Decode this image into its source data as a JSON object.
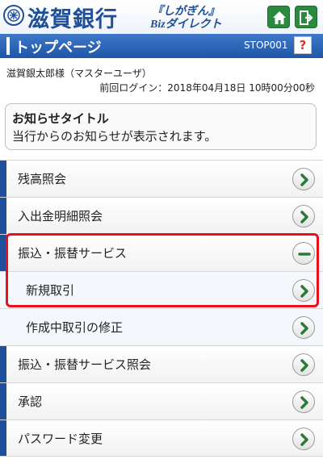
{
  "header": {
    "bank_name": "滋賀銀行",
    "tagline_top": "『しがぎん』",
    "tagline_biz": "Biz",
    "tagline_direct": "ダイレクト"
  },
  "titlebar": {
    "title": "トップページ",
    "code": "STOP001",
    "help": "?"
  },
  "user": {
    "name": "滋賀銀太郎様（マスターユーザ）",
    "last_login": "前回ログイン：2018年04月18日 10時00分00秒"
  },
  "notice": {
    "title": "お知らせタイトル",
    "body": "当行からのお知らせが表示されます。"
  },
  "menu": {
    "items": [
      {
        "label": "残高照会",
        "icon": "chevron-right-icon"
      },
      {
        "label": "入出金明細照会",
        "icon": "chevron-right-icon"
      },
      {
        "label": "振込・振替サービス",
        "icon": "minus-icon"
      },
      {
        "label": "新規取引",
        "icon": "chevron-right-icon"
      },
      {
        "label": "作成中取引の修正",
        "icon": "chevron-right-icon"
      },
      {
        "label": "振込・振替サービス照会",
        "icon": "chevron-right-icon"
      },
      {
        "label": "承認",
        "icon": "chevron-right-icon"
      },
      {
        "label": "パスワード変更",
        "icon": "chevron-right-icon"
      }
    ]
  },
  "colors": {
    "brand_blue": "#1f4f9a",
    "title_bar": "#2f66b8",
    "button_green": "#2c8a3e",
    "highlight_red": "#e8101a"
  }
}
